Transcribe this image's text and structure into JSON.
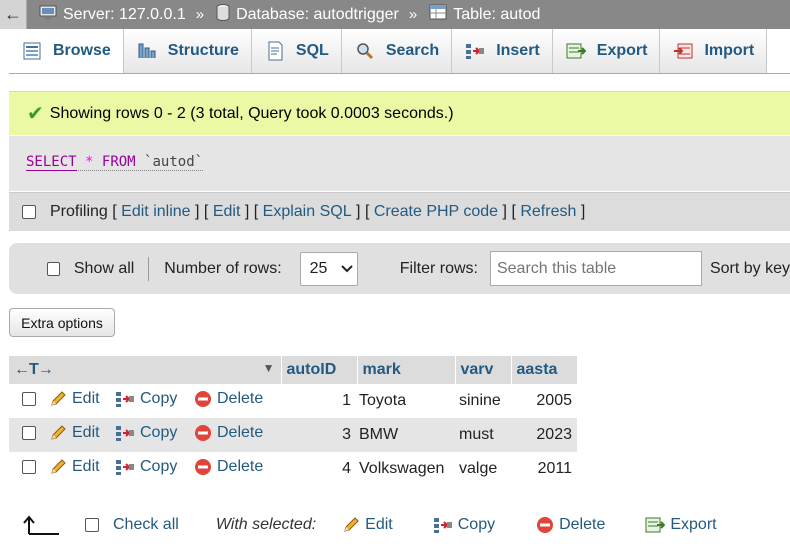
{
  "breadcrumb": {
    "back": "←",
    "server": "Server: 127.0.0.1",
    "database": "Database: autodtrigger",
    "table": "Table: autod",
    "separator": "»"
  },
  "tabs": [
    {
      "label": "Browse",
      "icon": "browse-icon",
      "active": true
    },
    {
      "label": "Structure",
      "icon": "structure-icon"
    },
    {
      "label": "SQL",
      "icon": "sql-icon"
    },
    {
      "label": "Search",
      "icon": "search-icon"
    },
    {
      "label": "Insert",
      "icon": "insert-icon"
    },
    {
      "label": "Export",
      "icon": "export-icon"
    },
    {
      "label": "Import",
      "icon": "import-icon"
    }
  ],
  "message": {
    "text": "Showing rows 0 - 2 (3 total, Query took 0.0003 seconds.)"
  },
  "sql": {
    "select": "SELECT",
    "star": "*",
    "from": "FROM",
    "table": "`autod`"
  },
  "profiling": {
    "label": "Profiling",
    "open": "[",
    "close": "]",
    "links": [
      "Edit inline",
      "Edit",
      "Explain SQL",
      "Create PHP code",
      "Refresh"
    ]
  },
  "nav": {
    "show_all": "Show all",
    "number_of_rows": "Number of rows:",
    "rows_value": "25",
    "filter_rows": "Filter rows:",
    "search_placeholder": "Search this table",
    "sort_by": "Sort by key"
  },
  "extra_options": "Extra options",
  "table": {
    "arrows": "←T→",
    "columns": [
      "autoID",
      "mark",
      "varv",
      "aasta"
    ],
    "actions": {
      "edit": "Edit",
      "copy": "Copy",
      "delete": "Delete"
    },
    "rows": [
      {
        "autoID": "1",
        "mark": "Toyota",
        "varv": "sinine",
        "aasta": "2005"
      },
      {
        "autoID": "3",
        "mark": "BMW",
        "varv": "must",
        "aasta": "2023"
      },
      {
        "autoID": "4",
        "mark": "Volkswagen",
        "varv": "valge",
        "aasta": "2011"
      }
    ]
  },
  "bottom": {
    "check_all": "Check all",
    "with_selected": "With selected:",
    "edit": "Edit",
    "copy": "Copy",
    "delete": "Delete",
    "export": "Export"
  },
  "colors": {
    "link": "#235a81",
    "success_bg": "#ebf8a4",
    "breadcrumb_bg": "#888888"
  }
}
